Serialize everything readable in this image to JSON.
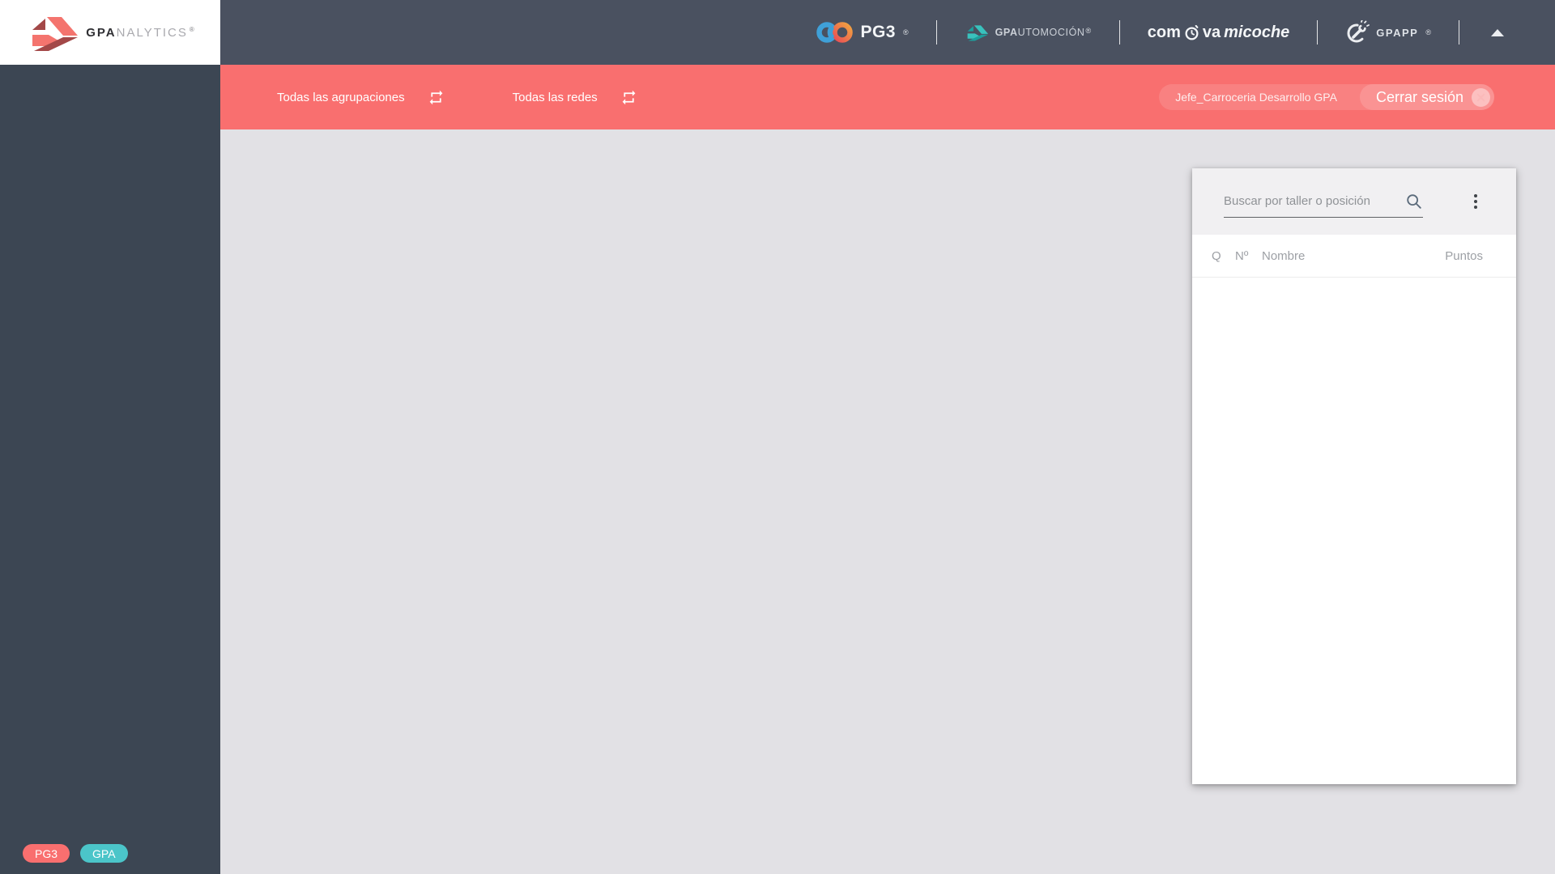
{
  "header": {
    "logo": {
      "bold": "GPA",
      "light": "NALYTICS",
      "reg": "®"
    },
    "brands": {
      "pg3": {
        "label": "PG3",
        "reg": "®"
      },
      "gpautomocion": {
        "bold": "GPA",
        "rest": "UTOMOCIÓN",
        "reg": "®"
      },
      "comovamicoche": {
        "pre": "com",
        "mid": "va",
        "italic": "micoche"
      },
      "gpapp": {
        "label": "GPAPP",
        "reg": "®"
      }
    }
  },
  "filter_bar": {
    "agrupaciones_label": "Todas las agrupaciones",
    "redes_label": "Todas las redes",
    "user": "Jefe_Carroceria Desarrollo GPA",
    "logout_label": "Cerrar sesión"
  },
  "sidebar": {
    "badges": [
      {
        "label": "PG3",
        "color": "#f96f6f"
      },
      {
        "label": "GPA",
        "color": "#4bc5c9"
      }
    ]
  },
  "panel": {
    "search_placeholder": "Buscar por taller o posición",
    "columns": [
      "Q",
      "Nº",
      "Nombre",
      "Puntos"
    ],
    "rows": []
  },
  "colors": {
    "header_bg": "#4a5160",
    "sidebar_bg": "#3c4653",
    "filter_bar_bg": "#f96f6f",
    "main_bg": "#e2e1e5",
    "panel_header_bg": "#f1f0f2",
    "accent_red": "#f96f6f",
    "accent_teal": "#4bc5c9"
  }
}
